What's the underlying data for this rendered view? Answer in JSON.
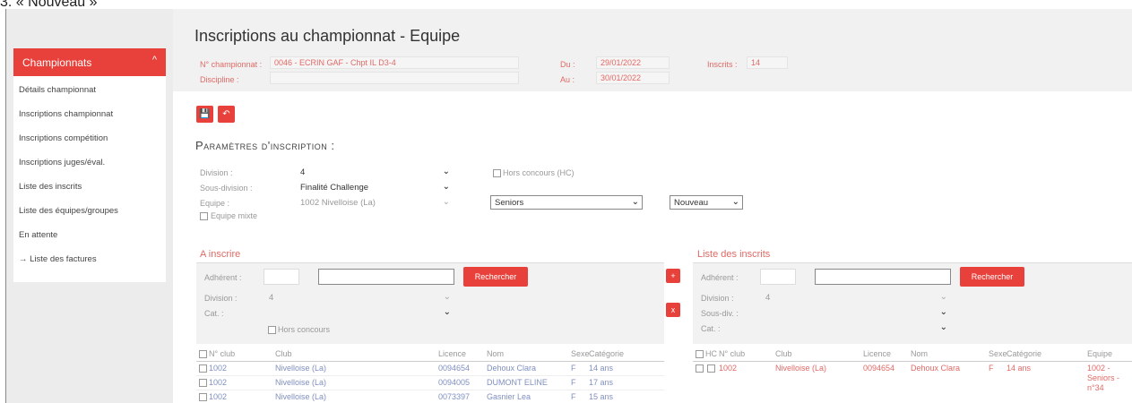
{
  "caption": "3.  « Nouveau »",
  "sidebar": {
    "header": "Championnats",
    "items": [
      {
        "label": "Détails championnat"
      },
      {
        "label": "Inscriptions championnat"
      },
      {
        "label": "Inscriptions compétition"
      },
      {
        "label": "Inscriptions juges/éval."
      },
      {
        "label": "Liste des inscrits"
      },
      {
        "label": "Liste des équipes/groupes"
      },
      {
        "label": "En attente"
      },
      {
        "label": "→ Liste des factures"
      }
    ]
  },
  "header": {
    "title": "Inscriptions au championnat - Equipe",
    "num_label": "N° championnat :",
    "num_value": "0046 - ECRIN GAF - Chpt IL D3-4",
    "discipline_label": "Discipline :",
    "du_label": "Du :",
    "du_value": "29/01/2022",
    "au_label": "Au :",
    "au_value": "30/01/2022",
    "inscrits_label": "Inscrits :",
    "inscrits_value": "14"
  },
  "toolbar": {
    "save_label": "💾",
    "back_label": "↶"
  },
  "params": {
    "title": "Paramètres d'inscription :",
    "division_label": "Division :",
    "division_value": "4",
    "hors_concours_label": "Hors concours (HC)",
    "sous_division_label": "Sous-division :",
    "sous_division_value": "Finalité Challenge",
    "equipe_label": "Equipe :",
    "equipe_value": "1002 Nivelloise (La)",
    "categorie_value": "Seniors",
    "niveau_value": "Nouveau",
    "equipe_mixte_label": "Equipe mixte"
  },
  "a_inscrire": {
    "title": "A inscrire",
    "adherent_label": "Adhérent :",
    "search_button": "Rechercher",
    "division_label": "Division :",
    "division_value": "4",
    "cat_label": "Cat. :",
    "hors_concours_label": "Hors concours",
    "columns": [
      "N° club",
      "Club",
      "Licence",
      "Nom",
      "Sexe",
      "Catégorie"
    ],
    "rows": [
      [
        "1002",
        "Nivelloise (La)",
        "0094654",
        "Dehoux Clara",
        "F",
        "14 ans"
      ],
      [
        "1002",
        "Nivelloise (La)",
        "0094005",
        "DUMONT ELINE",
        "F",
        "17 ans"
      ],
      [
        "1002",
        "Nivelloise (La)",
        "0073397",
        "Gasnier Lea",
        "F",
        "15 ans"
      ]
    ]
  },
  "transfer": {
    "add_label": "+",
    "remove_label": "x"
  },
  "inscrits": {
    "title": "Liste des inscrits",
    "adherent_label": "Adhérent :",
    "search_button": "Rechercher",
    "division_label": "Division :",
    "division_value": "4",
    "sous_div_label": "Sous-div. :",
    "cat_label": "Cat. :",
    "columns": [
      "HC",
      "N° club",
      "Club",
      "Licence",
      "Nom",
      "Sexe",
      "Catégorie",
      "Equipe"
    ],
    "rows": [
      [
        "1002",
        "Nivelloise (La)",
        "0094654",
        "Dehoux Clara",
        "F",
        "14 ans",
        "1002 - Seniors - n°34"
      ]
    ]
  }
}
